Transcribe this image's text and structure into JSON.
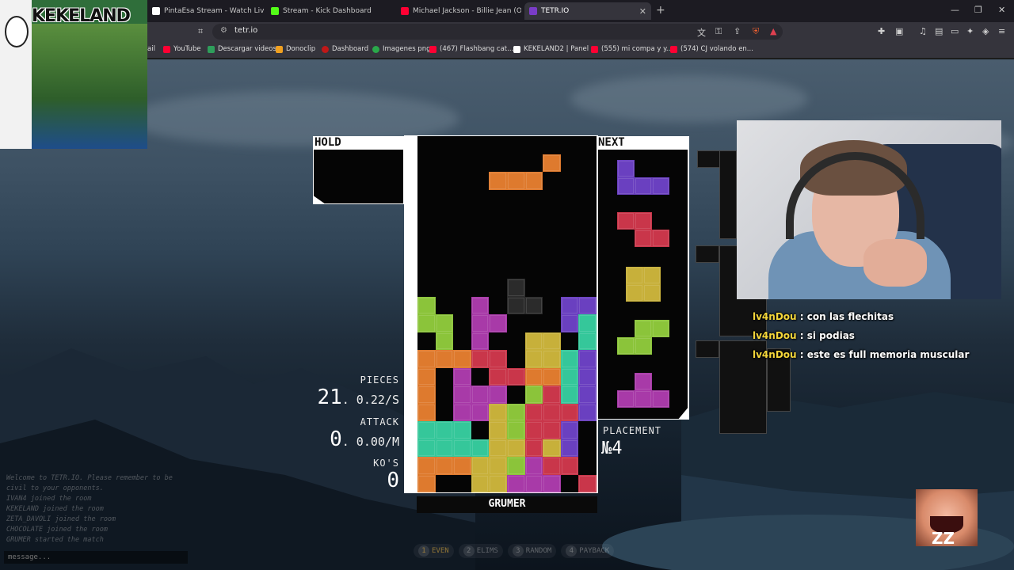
{
  "browser": {
    "tabs": [
      {
        "title": "PintaEsa Stream - Watch Live on",
        "color": "#ffffff",
        "active": false
      },
      {
        "title": "Stream - Kick Dashboard",
        "color": "#53fc18",
        "active": false
      },
      {
        "title": "Michael Jackson - Billie Jean (Official",
        "color": "#ff0033",
        "active": false
      },
      {
        "title": "TETR.IO",
        "color": "#7a3cc7",
        "active": true
      }
    ],
    "url": "tetr.io",
    "bookmarks": [
      {
        "label": "ail",
        "color": "#888888"
      },
      {
        "label": "YouTube",
        "color": "#ff0033"
      },
      {
        "label": "Descargar videos",
        "color": "#2e9e5b"
      },
      {
        "label": "Donoclip",
        "color": "#f0a020"
      },
      {
        "label": "Dashboard",
        "color": "#c01818"
      },
      {
        "label": "Imagenes png",
        "color": "#2aa84a"
      },
      {
        "label": "(467) Flashbang cat...",
        "color": "#ff0033"
      },
      {
        "label": "KEKELAND2 | Panel",
        "color": "#ffffff"
      },
      {
        "label": "(555) mi compa y y...",
        "color": "#ff0033"
      },
      {
        "label": "(574) CJ volando en...",
        "color": "#ff0033"
      }
    ]
  },
  "game": {
    "hold_label": "HOLD",
    "next_label": "NEXT",
    "player_name": "GRUMER",
    "stats": {
      "pieces_label": "PIECES",
      "pieces_value": "21",
      "pieces_rate": ".  0.22/S",
      "attack_label": "ATTACK",
      "attack_value": "0",
      "attack_rate": ".  0.00/M",
      "kos_label": "KO'S",
      "kos_value": "0"
    },
    "placement_label": "PLACEMENT",
    "placement_value": "№4",
    "colors": {
      "Z": "#c9364a",
      "S": "#8bc43a",
      "T": "#a83aa8",
      "L": "#de7a2e",
      "O": "#c7b03a",
      "J": "#6a40c0",
      "I": "#35c79a",
      "G": "#2b2b2b"
    },
    "board_rows": [
      "..........",
      "..........",
      "...... L..",
      "....LLL...",
      "..........",
      "..........",
      "..........",
      "..........",
      "..........",
      ".....G....",
      "S..T.GG.JJ",
      "SS.TT...JI",
      ".S.T..OO.I",
      "LLLZZ.OOIJ",
      "L.T.ZZLLIJ",
      "L.TTT.SZIJ",
      "L.TTOSZZZJ",
      "III.OSZZJ.",
      "IIIIOOZOJ.",
      "LLLOOSTZZ.",
      "L..OOTTT.Z"
    ],
    "next_pieces": [
      "J",
      "Z",
      "O",
      "S",
      "T"
    ],
    "mode_tabs": [
      {
        "num": "1",
        "label": "EVEN"
      },
      {
        "num": "2",
        "label": "ELIMS"
      },
      {
        "num": "3",
        "label": "RANDOM"
      },
      {
        "num": "4",
        "label": "PAYBACK"
      }
    ],
    "chat_log": [
      "Welcome to TETR.IO. Please remember to be",
      "civil to your opponents.",
      "IVAN4 joined the room",
      "KEKELAND joined the room",
      "ZETA_DAVOLI joined the room",
      "CHOCOLATE joined the room",
      "GRUMER started the match"
    ],
    "chat_placeholder": "message..."
  },
  "overlay": {
    "logo_text": "KEKELAND",
    "chat": [
      {
        "user": "lv4nDou",
        "message": "con las flechitas"
      },
      {
        "user": "lv4nDou",
        "message": "si podias"
      },
      {
        "user": "lv4nDou",
        "message": "este es full memoria muscular"
      }
    ]
  }
}
